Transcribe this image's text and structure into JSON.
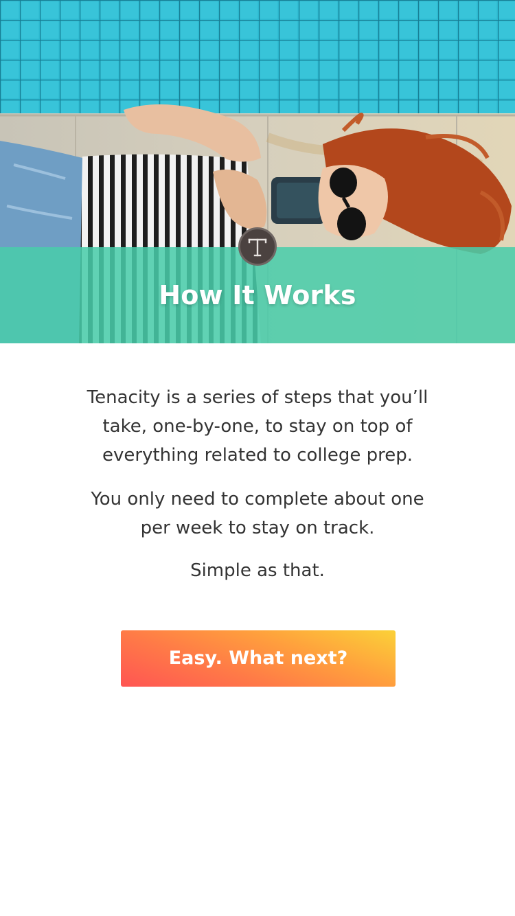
{
  "hero": {
    "title": "How It Works",
    "photo_description_icon": "pool-selfie-photo",
    "overlay_color": "#48CDAA",
    "logo_icon": "tenacity-t-logo-icon"
  },
  "content": {
    "paragraph_1": "Tenacity is a series of steps that you’ll take, one-by-one, to stay on top of everything related to college prep.",
    "paragraph_2": "You only need to complete about one per week to stay on track.",
    "paragraph_3": "Simple as that."
  },
  "cta": {
    "label": "Easy. What next?",
    "gradient_start": "#FF5553",
    "gradient_end": "#FBD138"
  }
}
